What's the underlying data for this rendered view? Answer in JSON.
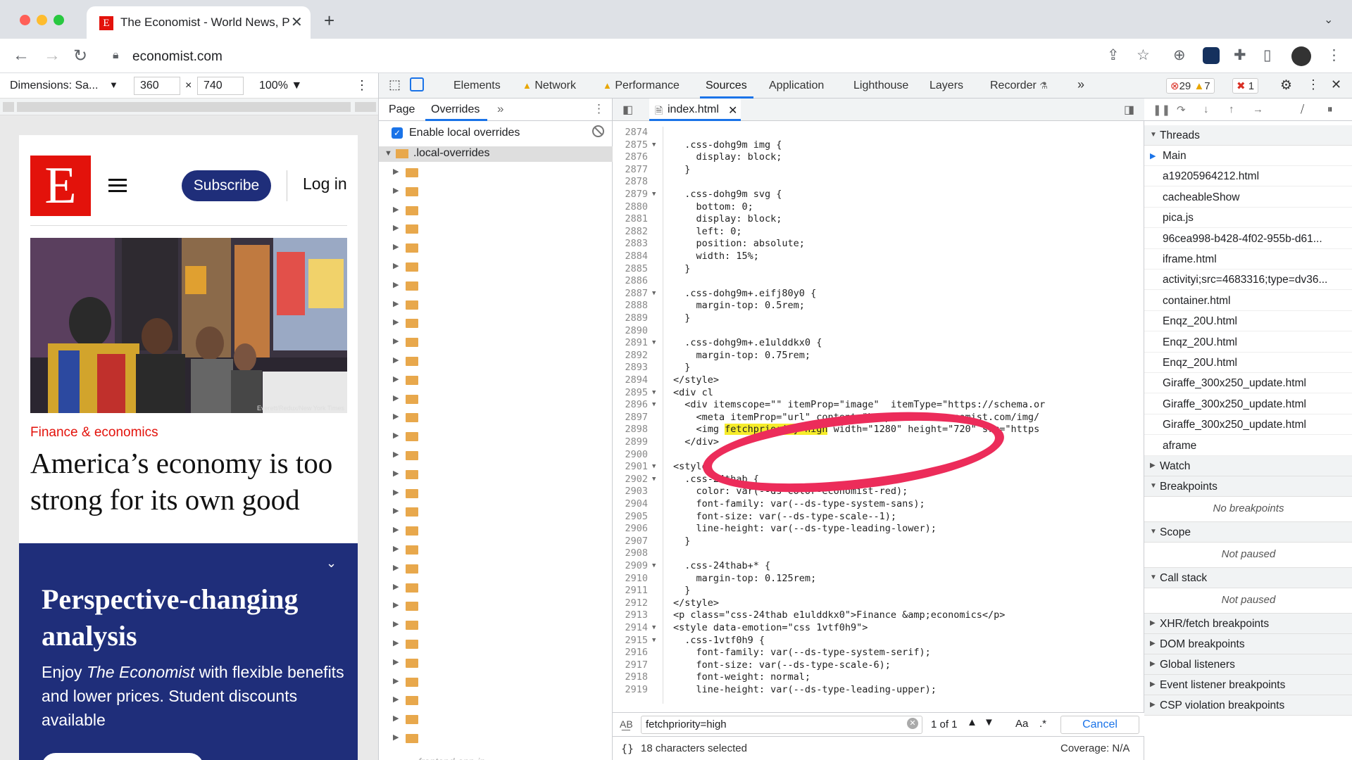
{
  "browser": {
    "tab_title": "The Economist - World News, P",
    "favicon_letter": "E",
    "address": "economist.com"
  },
  "device_toolbar": {
    "dimensions_label": "Dimensions: Sa...",
    "width": "360",
    "times": "×",
    "height": "740",
    "zoom": "100%"
  },
  "page": {
    "logo_letter": "E",
    "subscribe": "Subscribe",
    "login": "Log in",
    "photo_credit": "Everett/Redux/New York Times",
    "kicker": "Finance & economics",
    "headline": "America’s economy is too strong for its own good",
    "promo_title": "Perspective-changing analysis",
    "promo_text_pre": "Enjoy ",
    "promo_text_em": "The Economist",
    "promo_text_post": " with flexible benefits and lower prices. Student discounts available"
  },
  "devtools": {
    "tabs": [
      "Elements",
      "Network",
      "Performance",
      "Sources",
      "Application",
      "Lighthouse",
      "Layers",
      "Recorder"
    ],
    "more_tabs": "»",
    "errors": "29",
    "warnings": "7",
    "issues": "1",
    "navigator": {
      "tabs": [
        "Page",
        "Overrides"
      ],
      "enable_overrides": "Enable local overrides",
      "root_folder": ".local-overrides",
      "last_folder_fragment": "frontend-app-in"
    },
    "editor": {
      "file_tab": "index.html",
      "lines": [
        {
          "n": "2874",
          "t": ""
        },
        {
          "n": "2875",
          "t": "  .css-dohg9m img {",
          "f": true
        },
        {
          "n": "2876",
          "t": "    display: block;"
        },
        {
          "n": "2877",
          "t": "  }"
        },
        {
          "n": "2878",
          "t": ""
        },
        {
          "n": "2879",
          "t": "  .css-dohg9m svg {",
          "f": true
        },
        {
          "n": "2880",
          "t": "    bottom: 0;"
        },
        {
          "n": "2881",
          "t": "    display: block;"
        },
        {
          "n": "2882",
          "t": "    left: 0;"
        },
        {
          "n": "2883",
          "t": "    position: absolute;"
        },
        {
          "n": "2884",
          "t": "    width: 15%;"
        },
        {
          "n": "2885",
          "t": "  }"
        },
        {
          "n": "2886",
          "t": ""
        },
        {
          "n": "2887",
          "t": "  .css-dohg9m+.eifj80y0 {",
          "f": true
        },
        {
          "n": "2888",
          "t": "    margin-top: 0.5rem;"
        },
        {
          "n": "2889",
          "t": "  }"
        },
        {
          "n": "2890",
          "t": ""
        },
        {
          "n": "2891",
          "t": "  .css-dohg9m+.e1ulddkx0 {",
          "f": true
        },
        {
          "n": "2892",
          "t": "    margin-top: 0.75rem;"
        },
        {
          "n": "2893",
          "t": "  }"
        },
        {
          "n": "2894",
          "t": "</style>"
        },
        {
          "n": "2895",
          "t": "<div cl",
          "f": true
        },
        {
          "n": "2896",
          "t": "  <div itemscope=\"\" itemProp=\"image\"  itemType=\"https://schema.or",
          "f": true
        },
        {
          "n": "2897",
          "t": "    <meta itemProp=\"url\" content=\"https://www.economist.com/img/"
        },
        {
          "n": "2898",
          "t": "    <img ",
          "h": "fetchpriority=high",
          "after": " width=\"1280\" height=\"720\" src=\"https"
        },
        {
          "n": "2899",
          "t": "  </div>"
        },
        {
          "n": "2900",
          "t": ""
        },
        {
          "n": "2901",
          "t": "<style",
          "f": true
        },
        {
          "n": "2902",
          "t": "  .css-24thab {",
          "f": true
        },
        {
          "n": "2903",
          "t": "    color: var(--ds-color-economist-red);"
        },
        {
          "n": "2904",
          "t": "    font-family: var(--ds-type-system-sans);"
        },
        {
          "n": "2905",
          "t": "    font-size: var(--ds-type-scale--1);"
        },
        {
          "n": "2906",
          "t": "    line-height: var(--ds-type-leading-lower);"
        },
        {
          "n": "2907",
          "t": "  }"
        },
        {
          "n": "2908",
          "t": ""
        },
        {
          "n": "2909",
          "t": "  .css-24thab+* {",
          "f": true
        },
        {
          "n": "2910",
          "t": "    margin-top: 0.125rem;"
        },
        {
          "n": "2911",
          "t": "  }"
        },
        {
          "n": "2912",
          "t": "</style>"
        },
        {
          "n": "2913",
          "t": "<p class=\"css-24thab e1ulddkx0\">Finance &amp;economics</p>"
        },
        {
          "n": "2914",
          "t": "<style data-emotion=\"css 1vtf0h9\">",
          "f": true
        },
        {
          "n": "2915",
          "t": "  .css-1vtf0h9 {",
          "f": true
        },
        {
          "n": "2916",
          "t": "    font-family: var(--ds-type-system-serif);"
        },
        {
          "n": "2917",
          "t": "    font-size: var(--ds-type-scale-6);"
        },
        {
          "n": "2918",
          "t": "    font-weight: normal;"
        },
        {
          "n": "2919",
          "t": "    line-height: var(--ds-type-leading-upper);"
        }
      ],
      "search_value": "fetchpriority=high",
      "match_count": "1 of 1",
      "match_case": "Aa",
      "regex": ".*",
      "cancel": "Cancel",
      "status_left": "18 characters selected",
      "coverage": "Coverage: N/A"
    },
    "sidebar": {
      "threads_title": "Threads",
      "threads": [
        "Main",
        "a19205964212.html",
        "cacheableShow",
        "pica.js",
        "96cea998-b428-4f02-955b-d61...",
        "iframe.html",
        "activityi;src=4683316;type=dv36...",
        "container.html",
        "Enqz_20U.html",
        "Enqz_20U.html",
        "Enqz_20U.html",
        "Giraffe_300x250_update.html",
        "Giraffe_300x250_update.html",
        "Giraffe_300x250_update.html",
        "aframe"
      ],
      "watch": "Watch",
      "breakpoints": "Breakpoints",
      "no_breakpoints": "No breakpoints",
      "scope": "Scope",
      "not_paused": "Not paused",
      "call_stack": "Call stack",
      "not_paused_2": "Not paused",
      "sections": [
        "XHR/fetch breakpoints",
        "DOM breakpoints",
        "Global listeners",
        "Event listener breakpoints",
        "CSP violation breakpoints"
      ]
    }
  },
  "colors": {
    "economist_red": "#e3120b",
    "economist_blue": "#1f2e7a",
    "devtools_accent": "#1a73e8",
    "annotation_circle": "#ec2c5a",
    "search_highlight": "#f6ec2a"
  }
}
